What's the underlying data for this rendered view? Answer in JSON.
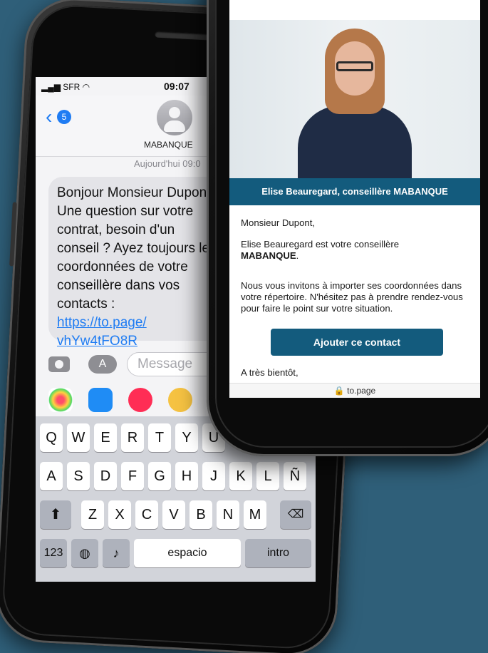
{
  "sms": {
    "status": {
      "carrier": "SFR",
      "time": "09:07"
    },
    "header": {
      "back_count": "5",
      "contact_name": "MABANQUE"
    },
    "date_line": "Aujourd'hui 09:0",
    "message": {
      "lines": [
        "Bonjour Monsieur Dupon",
        "Une question sur votre",
        "contrat, besoin d'un",
        "conseil ? Ayez toujours le",
        "coordonnées de votre",
        "conseillère dans vos",
        "contacts :"
      ],
      "link_lines": [
        "https://to.page/",
        "vhYw4tFO8R"
      ]
    },
    "input_placeholder": "Message",
    "keyboard": {
      "row1": [
        "Q",
        "W",
        "E",
        "R",
        "T",
        "Y",
        "U"
      ],
      "row2": [
        "A",
        "S",
        "D",
        "F",
        "G",
        "H",
        "J",
        "K",
        "L",
        "Ñ"
      ],
      "row3": [
        "Z",
        "X",
        "C",
        "V",
        "B",
        "N",
        "M"
      ],
      "numbers_label": "123",
      "space_label": "espacio",
      "return_label": "intro"
    }
  },
  "web": {
    "banner": "Elise Beauregard, conseillère MABANQUE",
    "greeting": "Monsieur Dupont,",
    "intro": "Elise Beauregard est votre conseillère",
    "bank": "MABANQUE",
    "bank_suffix": ".",
    "body": "Nous vous invitons à importer ses coordonnées dans votre répertoire. N'hésitez pas à prendre rendez-vous pour faire le point sur votre situation.",
    "cta": "Ajouter ce contact",
    "closing": "A très bientôt,",
    "url": "to.page"
  },
  "colors": {
    "background": "#2f5f79",
    "bank_blue": "#135b7d",
    "ios_blue": "#1f7cf3"
  }
}
